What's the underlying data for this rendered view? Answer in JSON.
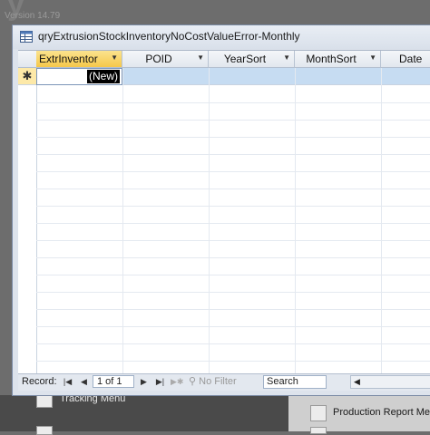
{
  "background": {
    "app_version": "Version 14.79",
    "buttons": [
      {
        "label": "Tracking Menu"
      },
      {
        "label": "Production Report Menu"
      }
    ]
  },
  "window": {
    "title": "qryExtrusionStockInventoryNoCostValueError-Monthly",
    "icon": "table-query-icon"
  },
  "datasheet": {
    "columns": [
      {
        "label": "ExtrInventor",
        "active": true
      },
      {
        "label": "POID"
      },
      {
        "label": "YearSort"
      },
      {
        "label": "MonthSort"
      },
      {
        "label": "Date"
      }
    ],
    "new_row_marker": "✱",
    "new_row_value": "(New)",
    "accent": "#f5c84a",
    "row_selected_color": "#c6dcf2"
  },
  "navigation": {
    "record_label": "Record:",
    "position": "1 of 1",
    "filter_label": "No Filter",
    "search_placeholder": "Search"
  }
}
